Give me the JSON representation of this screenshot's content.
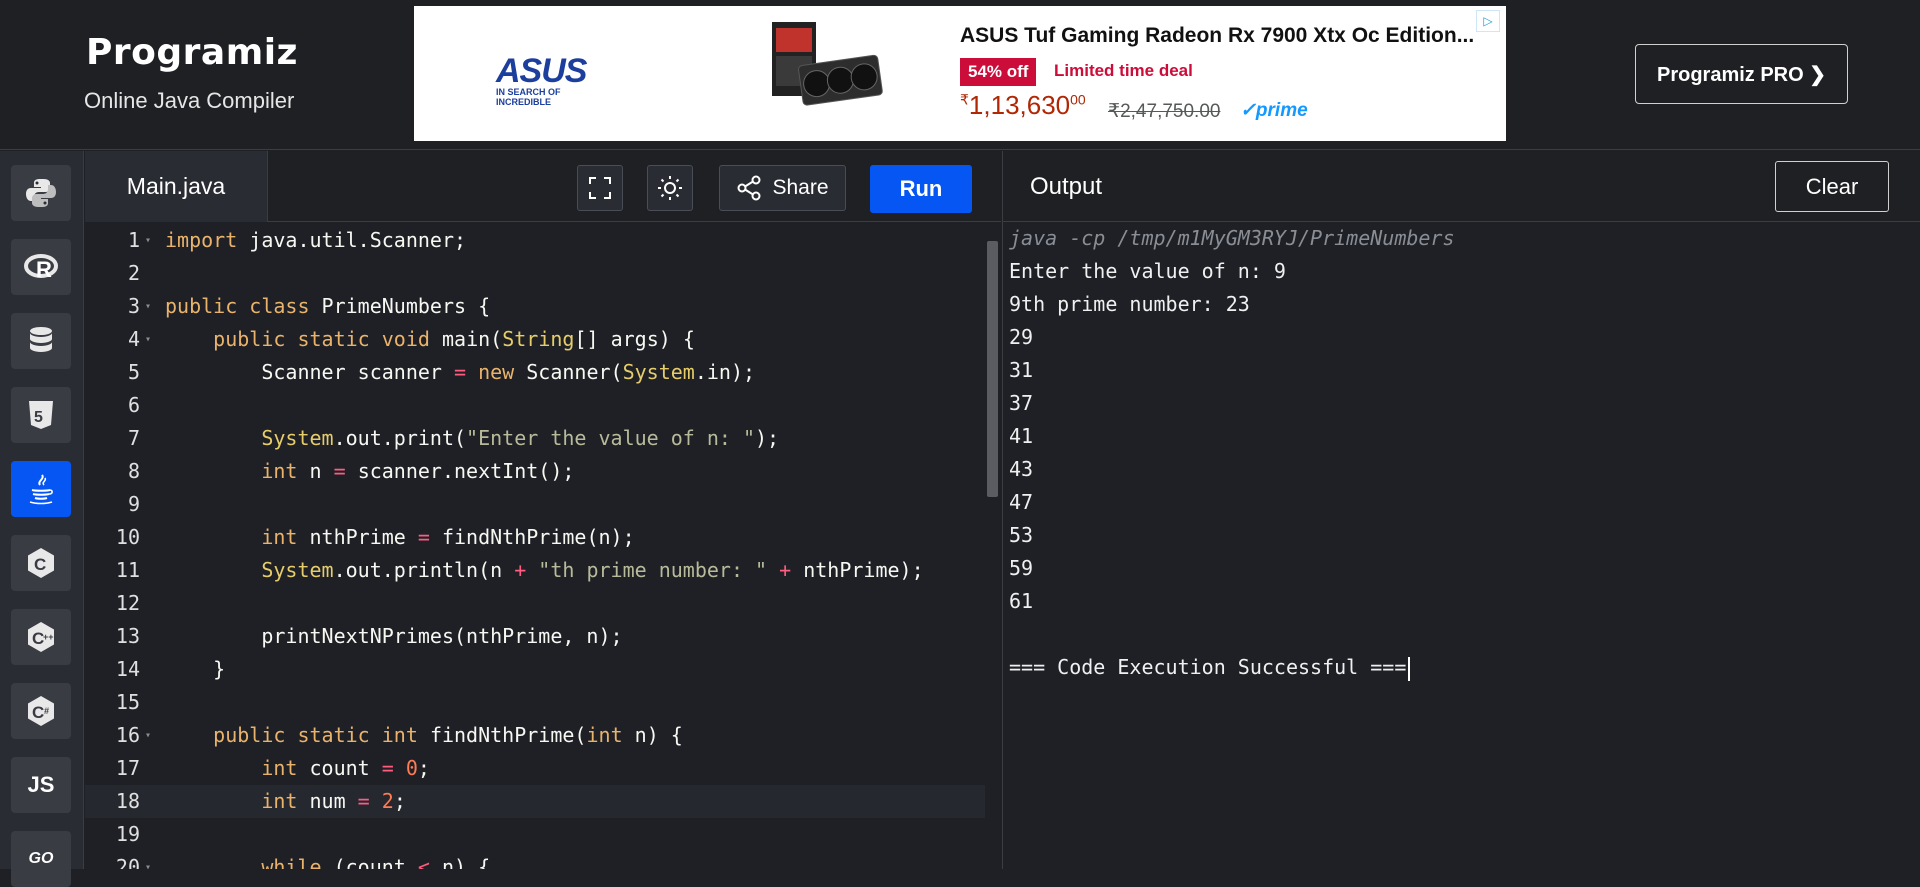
{
  "header": {
    "logo": "Programiz",
    "subtitle": "Online Java Compiler",
    "pro_button": "Programiz PRO ❯"
  },
  "ad": {
    "brand": "ASUS",
    "brand_tagline": "IN SEARCH OF INCREDIBLE",
    "title": "ASUS Tuf Gaming Radeon Rx 7900 Xtx Oc Edition...",
    "discount": "54% off",
    "deal": "Limited time deal",
    "price_symbol": "₹",
    "price": "1,13,630",
    "price_fraction": "00",
    "mrp": "₹2,47,750.00",
    "prime": "✓prime",
    "choice_icon": "adchoices-icon"
  },
  "sidebar": {
    "items": [
      {
        "name": "python",
        "icon": "python-icon",
        "label": ""
      },
      {
        "name": "r",
        "icon": "r-icon",
        "label": "R"
      },
      {
        "name": "sql",
        "icon": "database-icon",
        "label": ""
      },
      {
        "name": "html",
        "icon": "html5-icon",
        "label": "5"
      },
      {
        "name": "java",
        "icon": "java-icon",
        "label": ""
      },
      {
        "name": "c",
        "icon": "c-icon",
        "label": "C"
      },
      {
        "name": "cpp",
        "icon": "cpp-icon",
        "label": "C"
      },
      {
        "name": "csharp",
        "icon": "csharp-icon",
        "label": "C"
      },
      {
        "name": "js",
        "icon": "js-icon",
        "label": "JS"
      },
      {
        "name": "go",
        "icon": "go-icon",
        "label": "GO"
      }
    ],
    "active": "java"
  },
  "editor": {
    "tab": "Main.java",
    "share_label": "Share",
    "run_label": "Run",
    "highlighted_line": 18,
    "lines": [
      {
        "n": "1",
        "fold": true,
        "tokens": [
          [
            "kw",
            "import"
          ],
          [
            "",
            "java.util.Scanner;"
          ]
        ]
      },
      {
        "n": "2",
        "fold": false,
        "tokens": []
      },
      {
        "n": "3",
        "fold": true,
        "tokens": [
          [
            "kw",
            "public"
          ],
          [
            "",
            ""
          ],
          [
            "kw",
            "class"
          ],
          [
            "",
            "PrimeNumbers {"
          ]
        ]
      },
      {
        "n": "4",
        "fold": true,
        "tokens": [
          [
            "",
            "    "
          ],
          [
            "kw",
            "public"
          ],
          [
            "",
            ""
          ],
          [
            "kw",
            "static"
          ],
          [
            "",
            ""
          ],
          [
            "kw",
            "void"
          ],
          [
            "",
            "main("
          ],
          [
            "ty",
            "String"
          ],
          [
            "",
            "[] args) {"
          ]
        ]
      },
      {
        "n": "5",
        "fold": false,
        "tokens": [
          [
            "",
            "        Scanner scanner "
          ],
          [
            "op",
            "="
          ],
          [
            "",
            ""
          ],
          [
            "kw",
            "new"
          ],
          [
            "",
            "Scanner("
          ],
          [
            "ty",
            "System"
          ],
          [
            "",
            ".in);"
          ]
        ]
      },
      {
        "n": "6",
        "fold": false,
        "tokens": []
      },
      {
        "n": "7",
        "fold": false,
        "tokens": [
          [
            "",
            "        "
          ],
          [
            "ty",
            "System"
          ],
          [
            "",
            ".out.print("
          ],
          [
            "str",
            "\"Enter the value of n: \""
          ],
          [
            "",
            ");"
          ]
        ]
      },
      {
        "n": "8",
        "fold": false,
        "tokens": [
          [
            "",
            "        "
          ],
          [
            "kw",
            "int"
          ],
          [
            "",
            "n "
          ],
          [
            "op",
            "="
          ],
          [
            "",
            "scanner.nextInt();"
          ]
        ]
      },
      {
        "n": "9",
        "fold": false,
        "tokens": []
      },
      {
        "n": "10",
        "fold": false,
        "tokens": [
          [
            "",
            "        "
          ],
          [
            "kw",
            "int"
          ],
          [
            "",
            "nthPrime "
          ],
          [
            "op",
            "="
          ],
          [
            "",
            "findNthPrime(n);"
          ]
        ]
      },
      {
        "n": "11",
        "fold": false,
        "tokens": [
          [
            "",
            "        "
          ],
          [
            "ty",
            "System"
          ],
          [
            "",
            ".out.println(n "
          ],
          [
            "op",
            "+"
          ],
          [
            "",
            ""
          ],
          [
            "str",
            "\"th prime number: \""
          ],
          [
            "",
            ""
          ],
          [
            "op",
            "+"
          ],
          [
            "",
            "nthPrime);"
          ]
        ]
      },
      {
        "n": "12",
        "fold": false,
        "tokens": []
      },
      {
        "n": "13",
        "fold": false,
        "tokens": [
          [
            "",
            "        printNextNPrimes(nthPrime, n);"
          ]
        ]
      },
      {
        "n": "14",
        "fold": false,
        "tokens": [
          [
            "",
            "    }"
          ]
        ]
      },
      {
        "n": "15",
        "fold": false,
        "tokens": []
      },
      {
        "n": "16",
        "fold": true,
        "tokens": [
          [
            "",
            "    "
          ],
          [
            "kw",
            "public"
          ],
          [
            "",
            ""
          ],
          [
            "kw",
            "static"
          ],
          [
            "",
            ""
          ],
          [
            "kw",
            "int"
          ],
          [
            "",
            "findNthPrime("
          ],
          [
            "kw",
            "int"
          ],
          [
            "",
            "n) {"
          ]
        ]
      },
      {
        "n": "17",
        "fold": false,
        "tokens": [
          [
            "",
            "        "
          ],
          [
            "kw",
            "int"
          ],
          [
            "",
            "count "
          ],
          [
            "op",
            "="
          ],
          [
            "",
            ""
          ],
          [
            "num",
            "0"
          ],
          [
            "",
            ";"
          ]
        ]
      },
      {
        "n": "18",
        "fold": false,
        "tokens": [
          [
            "",
            "        "
          ],
          [
            "kw",
            "int"
          ],
          [
            "",
            "num "
          ],
          [
            "op",
            "="
          ],
          [
            "",
            ""
          ],
          [
            "num",
            "2"
          ],
          [
            "",
            ";"
          ]
        ]
      },
      {
        "n": "19",
        "fold": false,
        "tokens": []
      },
      {
        "n": "20",
        "fold": true,
        "tokens": [
          [
            "",
            "        "
          ],
          [
            "kw",
            "while"
          ],
          [
            "",
            " (count "
          ],
          [
            "op",
            "<"
          ],
          [
            "",
            "n) {"
          ]
        ]
      }
    ]
  },
  "output": {
    "title": "Output",
    "clear_label": "Clear",
    "lines": [
      {
        "text": "java -cp /tmp/m1MyGM3RYJ/PrimeNumbers",
        "cmd": true
      },
      {
        "text": "Enter the value of n: 9",
        "cmd": false
      },
      {
        "text": "9th prime number: 23",
        "cmd": false
      },
      {
        "text": "29",
        "cmd": false
      },
      {
        "text": "31",
        "cmd": false
      },
      {
        "text": "37",
        "cmd": false
      },
      {
        "text": "41",
        "cmd": false
      },
      {
        "text": "43",
        "cmd": false
      },
      {
        "text": "47",
        "cmd": false
      },
      {
        "text": "53",
        "cmd": false
      },
      {
        "text": "59",
        "cmd": false
      },
      {
        "text": "61",
        "cmd": false
      },
      {
        "text": "",
        "cmd": false
      },
      {
        "text": "=== Code Execution Successful ===",
        "cmd": false
      }
    ]
  }
}
